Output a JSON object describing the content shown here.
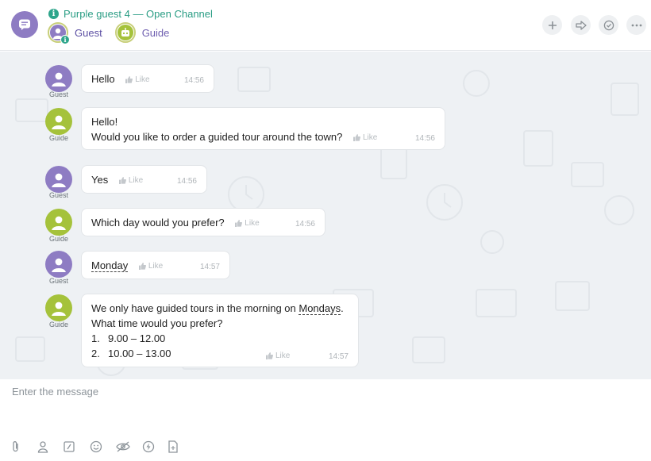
{
  "header": {
    "channel_title": "Purple guest 4 — Open Channel",
    "participants": [
      {
        "name": "Guest",
        "role": "guest"
      },
      {
        "name": "Guide",
        "role": "guide"
      }
    ],
    "actions": [
      "plus-icon",
      "forward-icon",
      "check-circle-icon",
      "more-icon"
    ]
  },
  "messages": [
    {
      "author": "Guest",
      "lines": [
        "Hello"
      ],
      "like": "Like",
      "time": "14:56"
    },
    {
      "author": "Guide",
      "lines": [
        "Hello!",
        "Would you like to order a guided tour around the town?"
      ],
      "like": "Like",
      "time": "14:56"
    },
    {
      "author": "Guest",
      "lines": [
        "Yes"
      ],
      "like": "Like",
      "time": "14:56"
    },
    {
      "author": "Guide",
      "lines": [
        "Which day would you prefer?"
      ],
      "like": "Like",
      "time": "14:56"
    },
    {
      "author": "Guest",
      "lines": [
        "Monday"
      ],
      "like": "Like",
      "time": "14:57"
    },
    {
      "author": "Guide",
      "lines": [
        "We only have guided tours in the morning on ",
        "Mondays",
        ".",
        "What time would you prefer?",
        "1.",
        "9.00 – 12.00",
        "2.",
        "10.00 – 13.00"
      ],
      "like": "Like",
      "time": "14:57"
    }
  ],
  "composer": {
    "placeholder": "Enter the message",
    "tools": [
      "paperclip-icon",
      "person-icon",
      "quick-reply-icon",
      "smile-icon",
      "hidden-eye-icon",
      "lightning-icon",
      "template-icon"
    ]
  },
  "colors": {
    "guest_avatar": "#8e7cc3",
    "guide_avatar": "#a5c23b",
    "accent_teal": "#2a9d84",
    "chat_background": "#eef1f4"
  }
}
